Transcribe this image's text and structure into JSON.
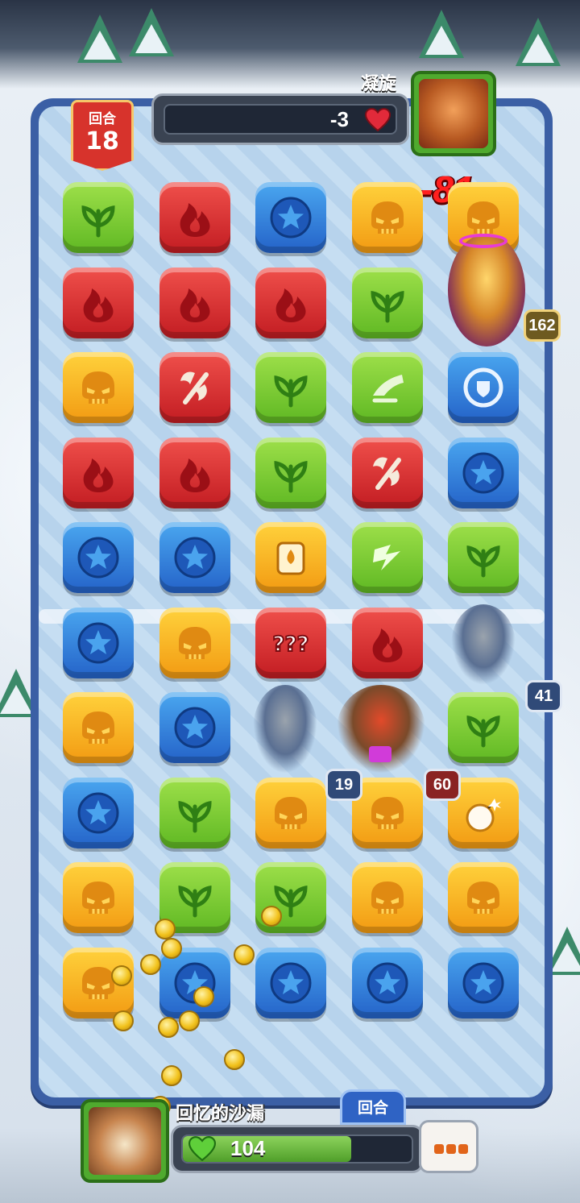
{
  "round": {
    "label": "回合",
    "number": "18"
  },
  "enemy": {
    "name": "凝旋",
    "value": "-3",
    "icon": "dragon-boss-portrait"
  },
  "damage_popup": "-81",
  "badges": [
    {
      "name": "boss-hp-badge",
      "value": "162"
    },
    {
      "name": "hammer-knight-hp-badge",
      "value": "41"
    },
    {
      "name": "left-knight-hp-badge",
      "value": "19"
    },
    {
      "name": "hero-hp-badge",
      "value": "60"
    }
  ],
  "board": {
    "rows": [
      [
        "green-leaf",
        "red-flame",
        "blue-star",
        "yellow-skull",
        "yellow-skull"
      ],
      [
        "red-flame",
        "red-flame",
        "red-flame",
        "green-leaf",
        "boss"
      ],
      [
        "yellow-skull",
        "red-axe",
        "green-leaf",
        "green-boot",
        "blue-shield"
      ],
      [
        "red-flame",
        "red-flame",
        "green-leaf",
        "red-axe",
        "blue-star"
      ],
      [
        "blue-star",
        "blue-star",
        "yellow-potion",
        "green-lightning",
        "green-leaf"
      ],
      [
        "blue-star",
        "yellow-skull",
        "red-mystery",
        "red-flame",
        "empty"
      ],
      [
        "yellow-skull",
        "blue-star",
        "empty",
        "empty",
        "green-leaf"
      ],
      [
        "blue-star",
        "green-leaf",
        "yellow-skull",
        "yellow-skull",
        "yellow-bomb"
      ],
      [
        "yellow-skull",
        "green-leaf",
        "green-leaf",
        "yellow-skull",
        "yellow-skull"
      ],
      [
        "yellow-skull",
        "blue-star",
        "blue-star",
        "blue-star",
        "blue-star"
      ]
    ]
  },
  "hero": {
    "name": "回忆的沙漏",
    "icon": "camel-hero-portrait"
  },
  "round_tab": "回合",
  "hp": {
    "value": "104",
    "fill_fraction": 0.72
  },
  "more_button": {
    "icon": "three-dots-icon"
  }
}
